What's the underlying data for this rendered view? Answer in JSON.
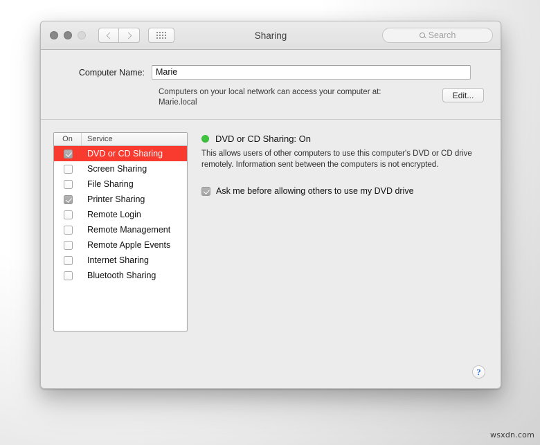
{
  "window": {
    "title": "Sharing",
    "traffic_lights": [
      "close",
      "minimize",
      "zoom"
    ],
    "nav": {
      "back_icon": "chevron-left-icon",
      "forward_icon": "chevron-right-icon",
      "showall_icon": "grid-dots-icon"
    },
    "search": {
      "placeholder": "Search",
      "icon": "search-icon",
      "value": ""
    }
  },
  "computer_name": {
    "label": "Computer Name:",
    "value": "Marie",
    "hint_line1": "Computers on your local network can access your computer at:",
    "hint_line2": "Marie.local",
    "edit_button": "Edit..."
  },
  "service_list": {
    "columns": [
      "On",
      "Service"
    ],
    "rows": [
      {
        "name": "DVD or CD Sharing",
        "checked": true,
        "selected": true
      },
      {
        "name": "Screen Sharing",
        "checked": false,
        "selected": false
      },
      {
        "name": "File Sharing",
        "checked": false,
        "selected": false
      },
      {
        "name": "Printer Sharing",
        "checked": true,
        "selected": false
      },
      {
        "name": "Remote Login",
        "checked": false,
        "selected": false
      },
      {
        "name": "Remote Management",
        "checked": false,
        "selected": false
      },
      {
        "name": "Remote Apple Events",
        "checked": false,
        "selected": false
      },
      {
        "name": "Internet Sharing",
        "checked": false,
        "selected": false
      },
      {
        "name": "Bluetooth Sharing",
        "checked": false,
        "selected": false
      }
    ]
  },
  "detail": {
    "status_dot_color": "#3ec43e",
    "status_title": "DVD or CD Sharing: On",
    "description": "This allows users of other computers to use this computer's DVD or CD drive remotely. Information sent between the computers is not encrypted.",
    "option_label": "Ask me before allowing others to use my DVD drive",
    "option_checked": true
  },
  "footer": {
    "help_label": "?"
  },
  "watermark": "wsxdn.com",
  "colors": {
    "selection_red": "#f93a2f",
    "status_green": "#3ec43e",
    "help_blue": "#2f6fd0"
  }
}
